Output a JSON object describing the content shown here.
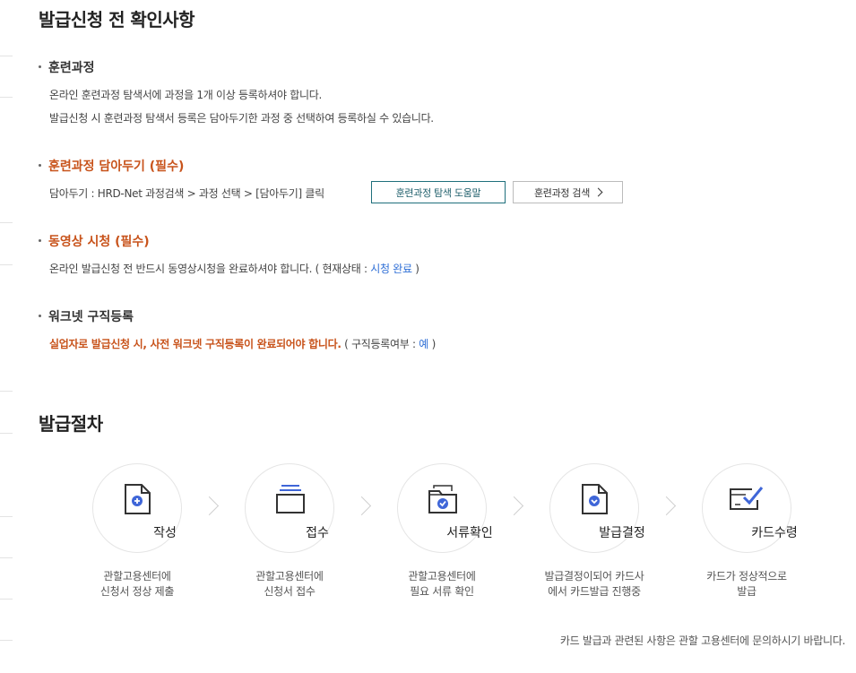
{
  "checklist": {
    "title": "발급신청 전 확인사항",
    "training": {
      "title": "훈련과정",
      "line1": "온라인 훈련과정 탐색서에 과정을 1개 이상 등록하셔야 합니다.",
      "line2": "발급신청 시 훈련과정 탐색서 등록은 담아두기한 과정 중 선택하여 등록하실 수 있습니다."
    },
    "save": {
      "title": "훈련과정 담아두기 (필수)",
      "text": "담아두기 : HRD-Net 과정검색 > 과정 선택 > [담아두기] 클릭",
      "help_button": "훈련과정 탐색 도움말",
      "search_button": "훈련과정 검색"
    },
    "video": {
      "title": "동영상 시청 (필수)",
      "text": "온라인 발급신청 전 반드시 동영상시청을 완료하셔야 합니다. ( 현재상태 :",
      "status": "시청 완료",
      "close": ")"
    },
    "worknet": {
      "title": "워크넷 구직등록",
      "warning": "실업자로 발급신청 시, 사전 워크넷 구직등록이 완료되어야 합니다.",
      "text": "( 구직등록여부 :",
      "status": "예",
      "close": ")"
    }
  },
  "procedure": {
    "title": "발급절차",
    "steps": [
      {
        "label": "작성",
        "icon": "document-plus-icon",
        "desc1": "관할고용센터에",
        "desc2": "신청서 정상 제출"
      },
      {
        "label": "접수",
        "icon": "tray-icon",
        "desc1": "관할고용센터에",
        "desc2": "신청서 접수"
      },
      {
        "label": "서류확인",
        "icon": "folder-check-icon",
        "desc1": "관할고용센터에",
        "desc2": "필요 서류 확인"
      },
      {
        "label": "발급결정",
        "icon": "document-check-icon",
        "desc1": "발급결정이되어 카드사",
        "desc2": "에서 카드발급 진행중"
      },
      {
        "label": "카드수령",
        "icon": "card-check-icon",
        "desc1": "카드가 정상적으로",
        "desc2": "발급"
      }
    ],
    "footnote": "카드 발급과 관련된 사항은 관할 고용센터에 문의하시기 바랍니다."
  },
  "colors": {
    "accent_orange": "#c8531b",
    "accent_blue": "#2f6fd6",
    "icon_blue": "#3f66d8",
    "teal_border": "#1f6f7c"
  }
}
